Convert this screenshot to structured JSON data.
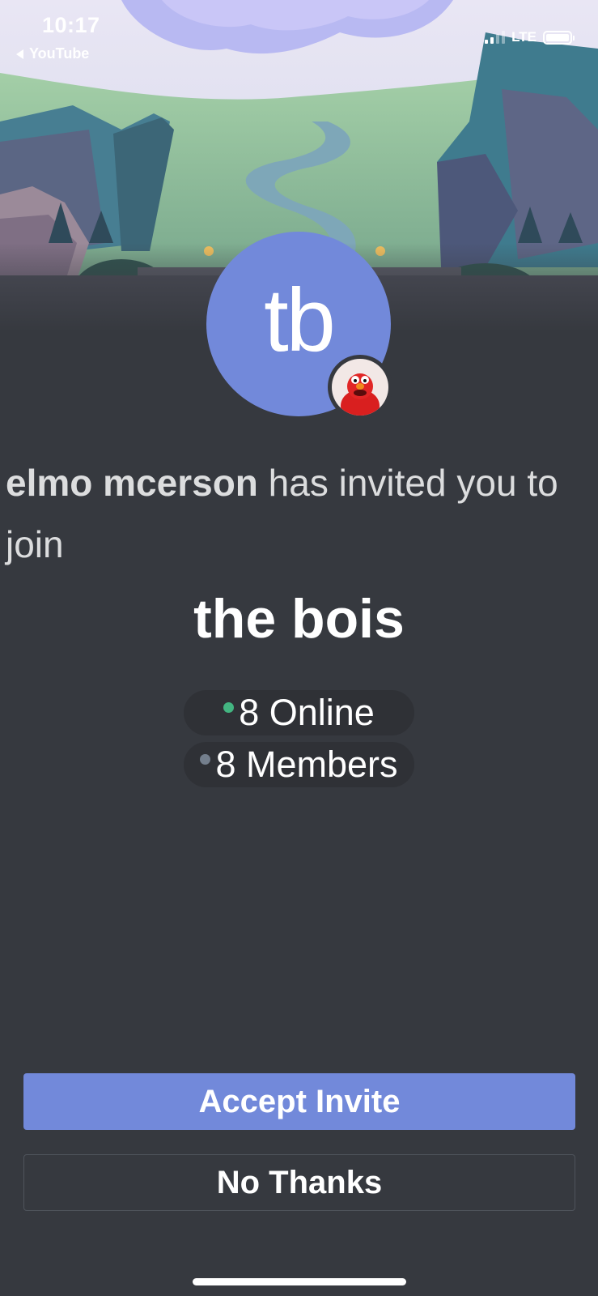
{
  "status_bar": {
    "time": "10:17",
    "back_label": "YouTube",
    "network": "LTE"
  },
  "invite": {
    "inviter_name": "elmo mcerson",
    "message": " has invited you to join",
    "server_acronym": "tb",
    "server_name": "the bois",
    "online_label": "8 Online",
    "members_label": "8 Members"
  },
  "actions": {
    "accept_label": "Accept Invite",
    "decline_label": "No Thanks"
  },
  "colors": {
    "background": "#36393f",
    "blurple": "#7289da",
    "online": "#43b581",
    "offline": "#747f8d",
    "pill": "#2f3136"
  }
}
